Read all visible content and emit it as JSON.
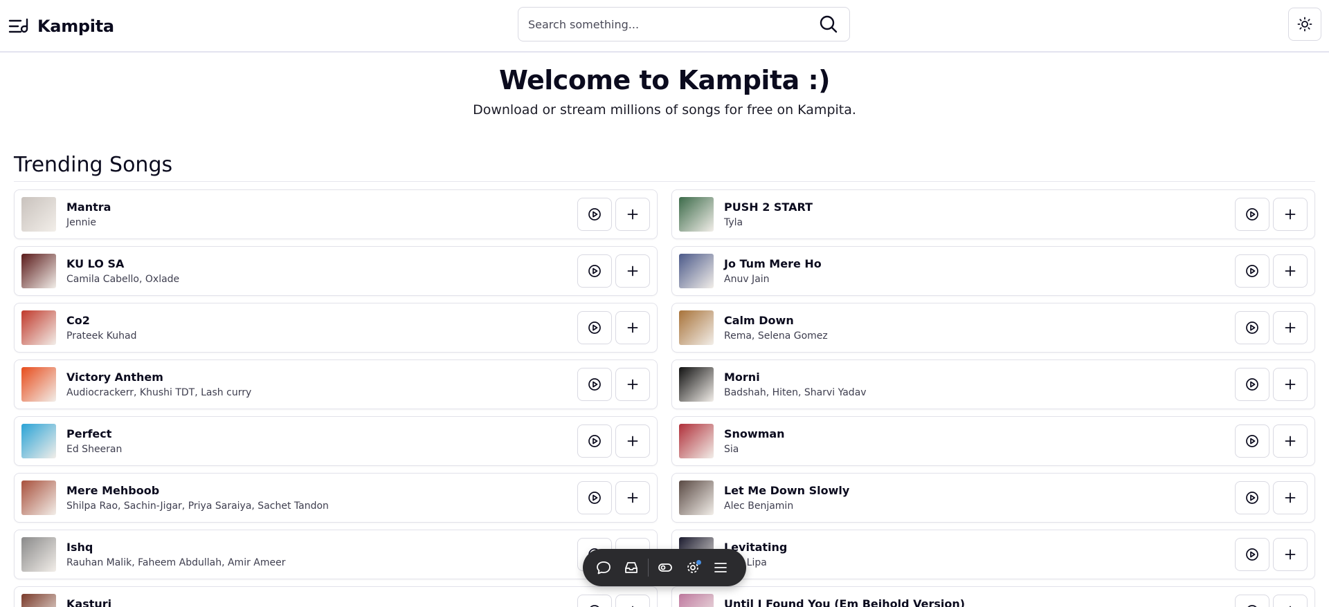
{
  "header": {
    "brand": "Kampita",
    "search_placeholder": "Search something..."
  },
  "hero": {
    "title": "Welcome to Kampita :)",
    "subtitle": "Download or stream millions of songs for free on Kampita."
  },
  "trending": {
    "title": "Trending Songs",
    "songs": [
      {
        "title": "Mantra",
        "artist": "Jennie",
        "art": "#c9c2bd"
      },
      {
        "title": "PUSH 2 START",
        "artist": "Tyla",
        "art": "#3c6b4a"
      },
      {
        "title": "KU LO SA",
        "artist": "Camila Cabello, Oxlade",
        "art": "#5a1a1a"
      },
      {
        "title": "Jo Tum Mere Ho",
        "artist": "Anuv Jain",
        "art": "#4c5a8a"
      },
      {
        "title": "Co2",
        "artist": "Prateek Kuhad",
        "art": "#c0392b"
      },
      {
        "title": "Calm Down",
        "artist": "Rema, Selena Gomez",
        "art": "#a8733a"
      },
      {
        "title": "Victory Anthem",
        "artist": "Audiocrackerr, Khushi TDT, Lash curry",
        "art": "#e74c1c"
      },
      {
        "title": "Morni",
        "artist": "Badshah, Hiten, Sharvi Yadav",
        "art": "#111111"
      },
      {
        "title": "Perfect",
        "artist": "Ed Sheeran",
        "art": "#2aa3d6"
      },
      {
        "title": "Snowman",
        "artist": "Sia",
        "art": "#b0303a"
      },
      {
        "title": "Mere Mehboob",
        "artist": "Shilpa Rao, Sachin-Jigar, Priya Saraiya, Sachet Tandon",
        "art": "#a8503c"
      },
      {
        "title": "Let Me Down Slowly",
        "artist": "Alec Benjamin",
        "art": "#5a4a44"
      },
      {
        "title": "Ishq",
        "artist": "Rauhan Malik, Faheem Abdullah, Amir Ameer",
        "art": "#8a8a8a"
      },
      {
        "title": "Levitating",
        "artist": "Dua Lipa",
        "art": "#1a1a2e"
      },
      {
        "title": "Kasturi",
        "artist": "",
        "art": "#7a3a2a"
      },
      {
        "title": "Until I Found You (Em Beihold Version)",
        "artist": "",
        "art": "#c07aa0"
      }
    ]
  },
  "icons": {
    "menu": "menu-icon",
    "search": "search-icon",
    "theme": "sun-icon",
    "play": "play-circle-icon",
    "add": "plus-icon",
    "dock": [
      "chat-icon",
      "inbox-icon",
      "toggle-icon",
      "settings-icon",
      "list-icon"
    ]
  },
  "colors": {
    "text": "#0b0b1e",
    "border": "#e2e2ea",
    "dock": "#2b2b2e",
    "dock_dot": "#4a90e2"
  }
}
